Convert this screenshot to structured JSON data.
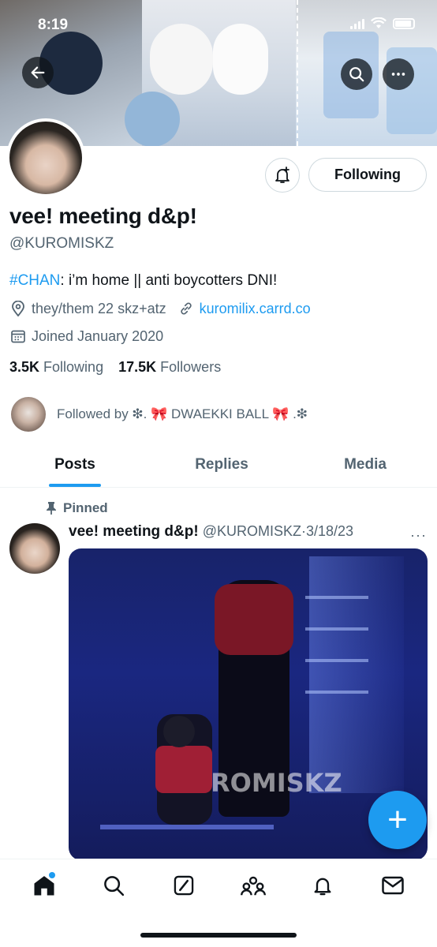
{
  "status_bar": {
    "time": "8:19"
  },
  "header": {
    "back_icon": "arrow-left-icon",
    "search_icon": "search-icon",
    "more_icon": "more-horizontal-icon"
  },
  "profile": {
    "display_name": "vee! meeting d&p!",
    "handle": "@KUROMISKZ",
    "bio_hashtag": "#CHAN",
    "bio_text": ": i’m home || anti boycotters DNI!",
    "pronouns": "they/them 22 skz+atz",
    "link": "kuromilix.carrd.co",
    "joined": "Joined January 2020",
    "following_count": "3.5K",
    "following_label": "Following",
    "followers_count": "17.5K",
    "followers_label": "Followers",
    "followed_by": "Followed by ❇︎. 🎀 DWAEKKI BALL 🎀 .❇︎",
    "follow_button": "Following"
  },
  "tabs": [
    {
      "label": "Posts",
      "active": true
    },
    {
      "label": "Replies",
      "active": false
    },
    {
      "label": "Media",
      "active": false
    }
  ],
  "post": {
    "pinned_label": "Pinned",
    "author": "vee! meeting d&p!",
    "handle": "@KUROMISKZ",
    "separator": "·",
    "date": "3/18/23",
    "more": "···",
    "watermark": "ROMISKZ"
  },
  "fab": {
    "label": "+"
  },
  "bottom_nav": [
    "home-icon",
    "search-icon",
    "grok-icon",
    "communities-icon",
    "notifications-icon",
    "messages-icon"
  ],
  "colors": {
    "accent": "#1d9bf0",
    "text": "#0f1419",
    "secondary": "#536471",
    "border": "#cfd9de"
  }
}
